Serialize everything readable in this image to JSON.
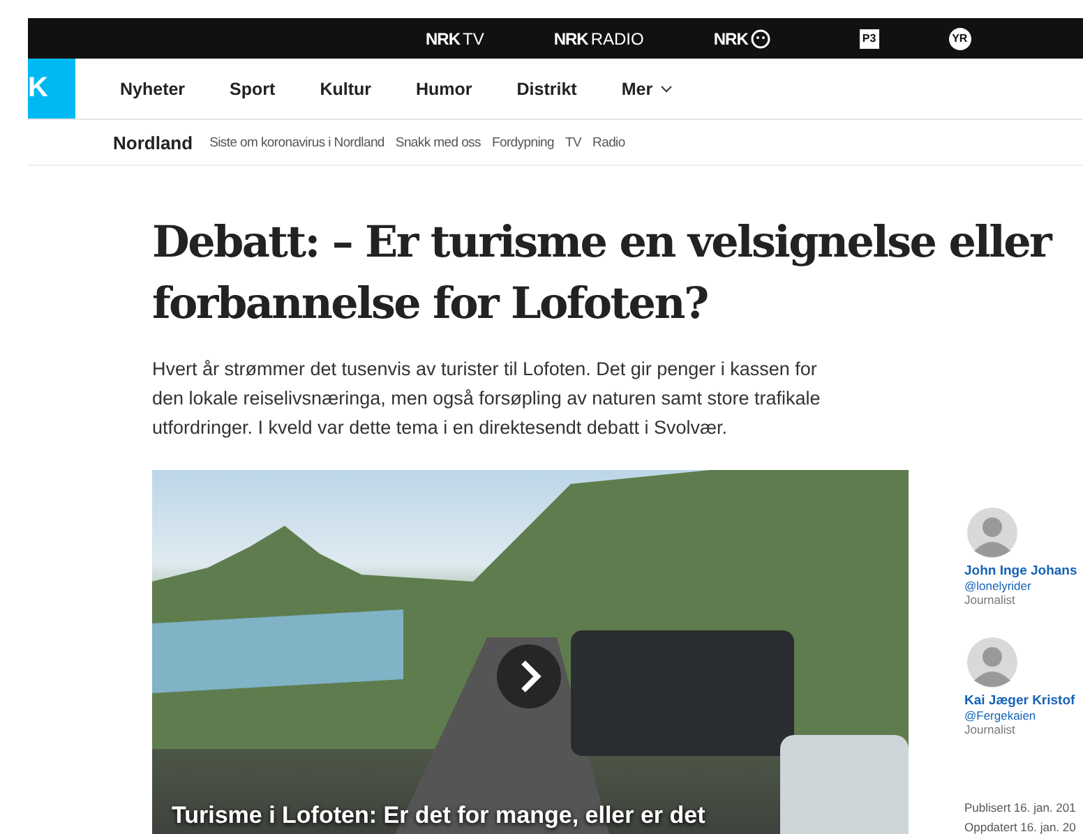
{
  "top_bar": {
    "services": [
      {
        "kind": "nrk",
        "brand": "NRK",
        "label": "TV"
      },
      {
        "kind": "nrk",
        "brand": "NRK",
        "label": "RADIO"
      },
      {
        "kind": "super",
        "brand": "NRK"
      },
      {
        "kind": "badge",
        "label": "P3"
      },
      {
        "kind": "round",
        "label": "YR"
      }
    ]
  },
  "logo": {
    "text": "K"
  },
  "main_nav": {
    "items": [
      {
        "label": "Nyheter",
        "dropdown": false
      },
      {
        "label": "Sport",
        "dropdown": false
      },
      {
        "label": "Kultur",
        "dropdown": false
      },
      {
        "label": "Humor",
        "dropdown": false
      },
      {
        "label": "Distrikt",
        "dropdown": false
      },
      {
        "label": "Mer",
        "dropdown": true
      }
    ]
  },
  "sub_nav": {
    "title": "Nordland",
    "items": [
      "Siste om koronavirus i Nordland",
      "Snakk med oss",
      "Fordypning",
      "TV",
      "Radio"
    ]
  },
  "article": {
    "title": "Debatt: – Er turisme en velsignelse eller forbannelse for Lofoten?",
    "lead": "Hvert år strømmer det tusenvis av turister til Lofoten. Det gir penger i kassen for den lokale reiselivsnæringa, men også forsøpling av naturen samt store trafikale utfordringer. I kveld var dette tema i en direktesendt debatt i Svolvær.",
    "video": {
      "caption": "Turisme i Lofoten: Er det for mange, eller er det"
    }
  },
  "sidebar": {
    "authors": [
      {
        "name": "John Inge Johans",
        "handle": "@lonelyrider",
        "role": "Journalist"
      },
      {
        "name": "Kai Jæger Kristof",
        "handle": "@Fergekaien",
        "role": "Journalist"
      }
    ],
    "published": "Publisert 16. jan. 201",
    "updated": "Oppdatert 16. jan. 20"
  }
}
